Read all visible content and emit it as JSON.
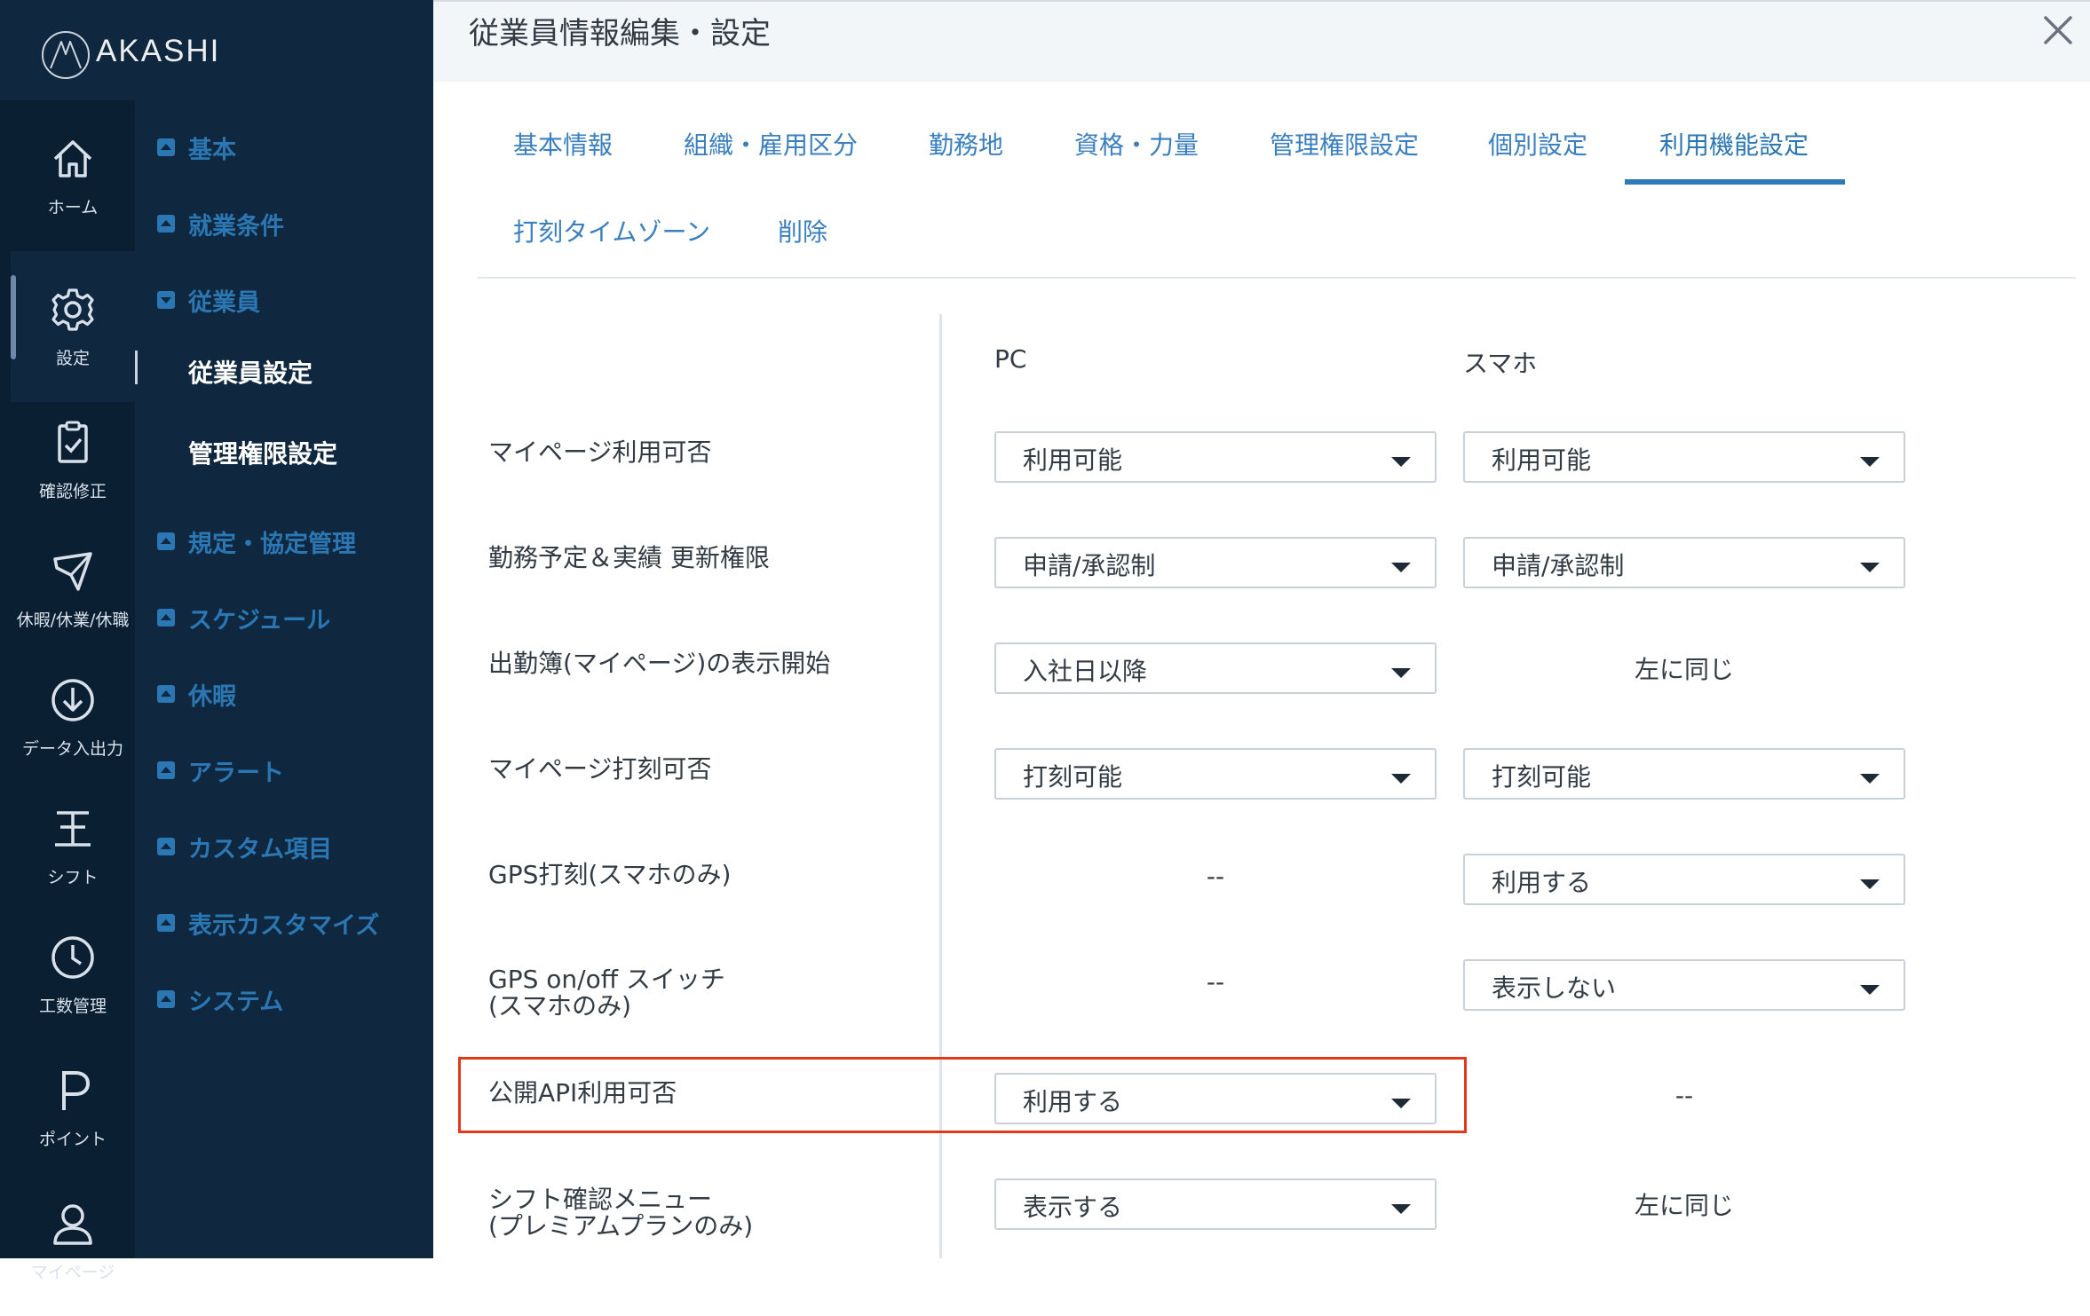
{
  "brand": {
    "name": "AKASHI"
  },
  "rail": [
    {
      "label": "ホーム",
      "icon": "home-icon"
    },
    {
      "label": "設定",
      "icon": "gear-icon"
    },
    {
      "label": "確認修正",
      "icon": "clipboard-icon"
    },
    {
      "label": "休暇/休業/休職",
      "icon": "plane-icon"
    },
    {
      "label": "データ入出力",
      "icon": "download-icon"
    },
    {
      "label": "シフト",
      "icon": "shift-icon"
    },
    {
      "label": "工数管理",
      "icon": "clock-icon"
    },
    {
      "label": "ポイント",
      "icon": "point-icon"
    },
    {
      "label": "マイページ",
      "icon": "user-icon"
    }
  ],
  "menu": {
    "items": [
      "基本",
      "就業条件",
      "従業員",
      "規定・協定管理",
      "スケジュール",
      "休暇",
      "アラート",
      "カスタム項目",
      "表示カスタマイズ",
      "システム"
    ],
    "sub_items": [
      "従業員設定",
      "管理権限設定"
    ]
  },
  "header": {
    "title": "従業員情報編集・設定"
  },
  "tabs": [
    "基本情報",
    "組織・雇用区分",
    "勤務地",
    "資格・力量",
    "管理権限設定",
    "個別設定",
    "利用機能設定",
    "打刻タイムゾーン",
    "削除"
  ],
  "active_tab": "利用機能設定",
  "columns": {
    "pc": "PC",
    "sp": "スマホ"
  },
  "rows": [
    {
      "label": "マイページ利用可否",
      "pc": "利用可能",
      "sp": "利用可能"
    },
    {
      "label": "勤務予定＆実績 更新権限",
      "pc": "申請/承認制",
      "sp": "申請/承認制"
    },
    {
      "label": "出勤簿(マイページ)の表示開始",
      "pc": "入社日以降",
      "sp": "左に同じ"
    },
    {
      "label": "マイページ打刻可否",
      "pc": "打刻可能",
      "sp": "打刻可能"
    },
    {
      "label": "GPS打刻(スマホのみ)",
      "pc": "--",
      "sp": "利用する"
    },
    {
      "label_line1": "GPS on/off スイッチ",
      "label_line2": "(スマホのみ)",
      "pc": "--",
      "sp": "表示しない"
    },
    {
      "label": "公開API利用可否",
      "pc": "利用する",
      "sp": "--"
    },
    {
      "label_line1": "シフト確認メニュー",
      "label_line2": "(プレミアムプランのみ)",
      "pc": "表示する",
      "sp": "左に同じ"
    }
  ],
  "colors": {
    "sidebar": "#0f2840",
    "accent": "#2b77b3",
    "highlight": "#e2391b"
  }
}
